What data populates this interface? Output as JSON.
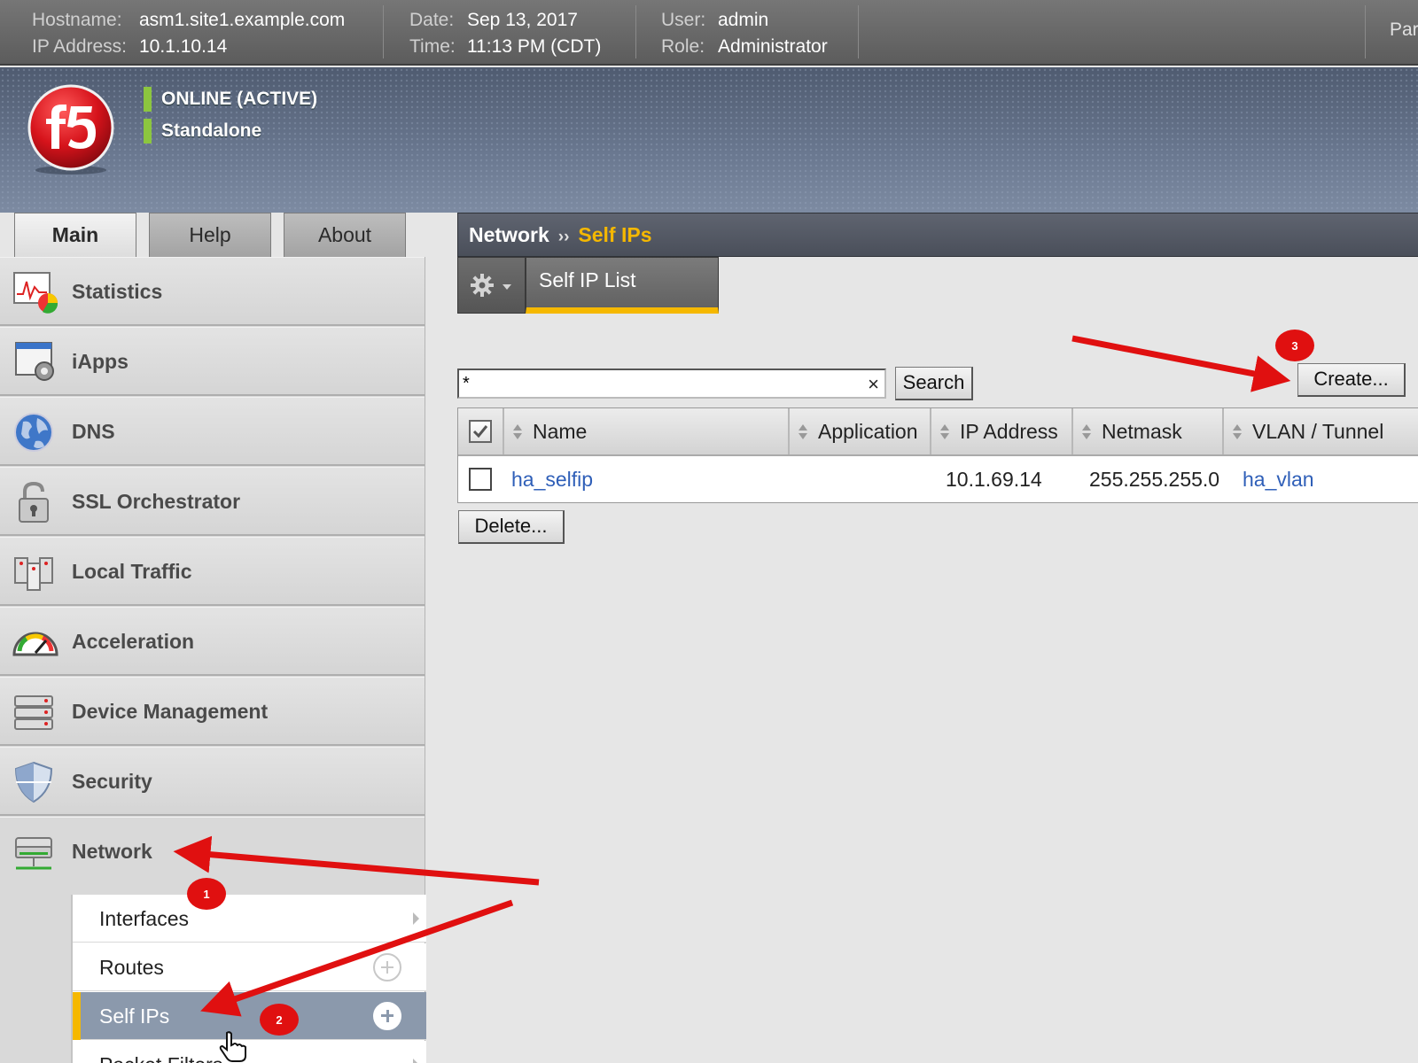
{
  "system_bar": {
    "hostname_label": "Hostname:",
    "hostname": "asm1.site1.example.com",
    "ip_label": "IP Address:",
    "ip": "10.1.10.14",
    "date_label": "Date:",
    "date": "Sep 13, 2017",
    "time_label": "Time:",
    "time": "11:13 PM (CDT)",
    "user_label": "User:",
    "user": "admin",
    "role_label": "Role:",
    "role": "Administrator",
    "partition_partial": "Par"
  },
  "banner": {
    "status": "ONLINE (ACTIVE)",
    "mode": "Standalone",
    "status_color": "#8cc63f"
  },
  "left_tabs": [
    {
      "label": "Main",
      "active": true
    },
    {
      "label": "Help",
      "active": false
    },
    {
      "label": "About",
      "active": false
    }
  ],
  "nav": {
    "items": [
      {
        "label": "Statistics",
        "icon": "statistics-icon"
      },
      {
        "label": "iApps",
        "icon": "iapps-icon"
      },
      {
        "label": "DNS",
        "icon": "globe-icon"
      },
      {
        "label": "SSL Orchestrator",
        "icon": "padlock-icon"
      },
      {
        "label": "Local Traffic",
        "icon": "local-traffic-icon"
      },
      {
        "label": "Acceleration",
        "icon": "speedometer-icon"
      },
      {
        "label": "Device Management",
        "icon": "server-stack-icon"
      },
      {
        "label": "Security",
        "icon": "shield-icon"
      },
      {
        "label": "Network",
        "icon": "network-icon",
        "expanded": true
      }
    ],
    "submenu": [
      {
        "label": "Interfaces"
      },
      {
        "label": "Routes"
      },
      {
        "label": "Self IPs",
        "active": true
      },
      {
        "label": "Packet Filters"
      }
    ]
  },
  "breadcrumb": {
    "section": "Network",
    "separator": "››",
    "current": "Self IPs"
  },
  "content_tabs": {
    "menu_icon": "gear-icon",
    "active": "Self IP List"
  },
  "search": {
    "value": "*",
    "button": "Search",
    "clear_glyph": "×"
  },
  "buttons": {
    "create": "Create...",
    "delete": "Delete..."
  },
  "table": {
    "columns": [
      "Name",
      "Application",
      "IP Address",
      "Netmask",
      "VLAN / Tunnel"
    ],
    "rows": [
      {
        "name": "ha_selfip",
        "application": "",
        "ip": "10.1.69.14",
        "netmask": "255.255.255.0",
        "vlan": "ha_vlan",
        "selected": false
      }
    ]
  },
  "annotations": {
    "badges": [
      "1",
      "2",
      "3"
    ],
    "arrow_color": "#e01010"
  },
  "colors": {
    "accent": "#f5b800",
    "link": "#2f5fb8",
    "active_sub_bg": "#8b99ac"
  }
}
